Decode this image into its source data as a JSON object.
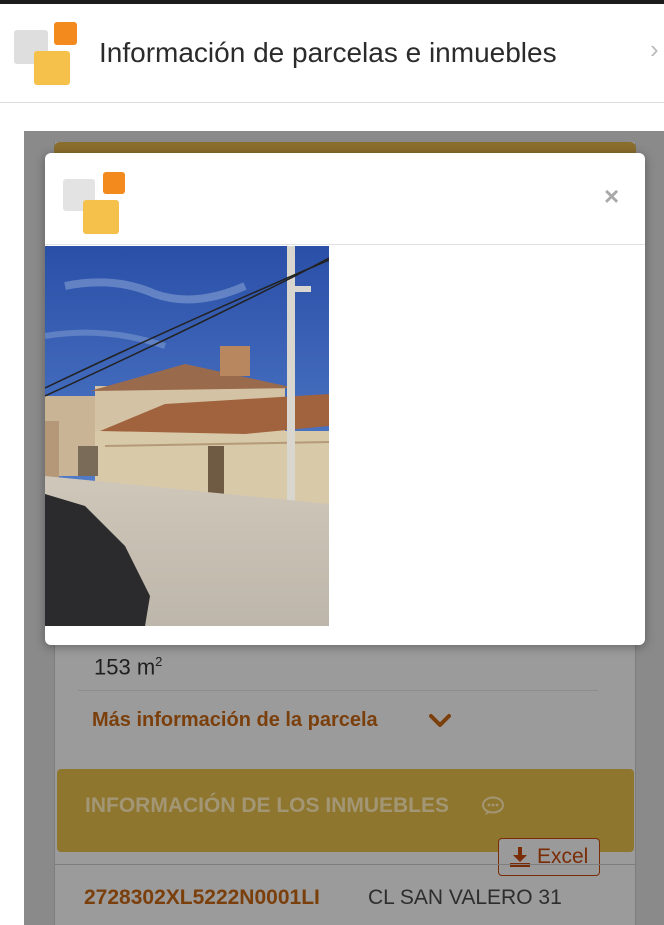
{
  "header": {
    "title": "Información de parcelas e inmuebles",
    "close_glyph": "›",
    "logo_icon": "catastro-logo-icon"
  },
  "modal": {
    "close_glyph": "×",
    "logo_icon": "catastro-logo-icon",
    "photo_icon": "building-facade-photo"
  },
  "background": {
    "area_value": "153 m",
    "area_exponent": "2",
    "more_info_link": "Más información de la parcela",
    "section_title": "INFORMACIÓN DE LOS INMUEBLES",
    "excel_button": "Excel",
    "property_ref": "2728302XL5222N0001LI",
    "property_address": "CL SAN VALERO 31"
  },
  "colors": {
    "brand_orange": "#f28a1e",
    "brand_yellow": "#f6c14b",
    "link_brown": "#b35a0f"
  }
}
